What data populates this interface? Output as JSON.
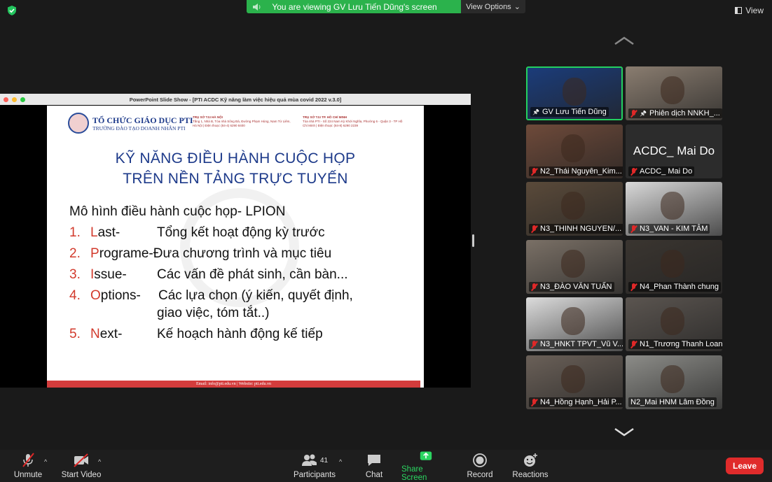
{
  "banner": {
    "text": "You are viewing GV Lưu Tiến Dũng's screen",
    "view_options": "View Options"
  },
  "view_label": "View",
  "shared_window": {
    "title": "PowerPoint Slide Show - [PTI ACDC Kỹ năng làm việc hiệu quả mùa covid 2022 v.3.0]"
  },
  "slide": {
    "org_name": "TỔ CHỨC GIÁO DỤC PTI",
    "org_sub": "TRƯỜNG ĐÀO TẠO DOANH NHÂN PTI",
    "addr_hn_title": "TRỤ SỞ TẠI HÀ NỘI",
    "addr_hn": "Tầng 1, Nhà B, Tòa nhà Sông Đà, Đường Phạm Hùng, Nam Từ Liêm, Hà Nội | Điện thoại: (84-4) 6290 8400",
    "addr_hcm_title": "TRỤ SỞ TẠI TP. HỒ CHÍ MINH",
    "addr_hcm": "Tòa nhà PTI - Số 224 Nam Kỳ Khởi Nghĩa, Phường 6 - Quận 3 - TP Hồ Chí Minh | Điện thoại: (84-8) 6290 2239",
    "title_line1": "KỸ NĂNG ĐIỀU HÀNH CUỘC HỌP",
    "title_line2": "TRÊN NỀN TẢNG TRỰC TUYẾN",
    "model": "Mô hình điều hành cuộc họp- LPION",
    "items": [
      {
        "num": "1.",
        "cap": "L",
        "rest": "ast-",
        "desc": "Tổng kết hoạt động kỳ trước"
      },
      {
        "num": "2.",
        "cap": "P",
        "rest": "rograme-",
        "desc": "Đưa chương trình và mục tiêu"
      },
      {
        "num": "3.",
        "cap": "I",
        "rest": "ssue-",
        "desc": "Các vấn đề phát sinh, cần bàn..."
      },
      {
        "num": "4.",
        "cap": "O",
        "rest": "ptions-",
        "desc": "Các lựa chọn (ý kiến, quyết định,",
        "desc2": "giao việc, tóm tắt..)"
      },
      {
        "num": "5.",
        "cap": "N",
        "rest": "ext-",
        "desc": "Kế hoạch hành động kế tiếp"
      }
    ],
    "footer": "Email: info@pti.edu.vn | Website: pti.edu.vn"
  },
  "participants": [
    {
      "name": "GV Lưu Tiến Dũng",
      "active": true,
      "muted": false,
      "pinned": true
    },
    {
      "name": "Phiên dịch NNKH_...",
      "muted": true,
      "pinned": true
    },
    {
      "name": "N2_Thái Nguyên_Kim...",
      "muted": true
    },
    {
      "name": "ACDC_ Mai Do",
      "muted": true,
      "display_name": "ACDC_ Mai Do"
    },
    {
      "name": "N3_THINH NGUYEN/...",
      "muted": true
    },
    {
      "name": "N3_VAN - KIM TÂM",
      "muted": true
    },
    {
      "name": "N3_ĐÀO VĂN TUẤN",
      "muted": true
    },
    {
      "name": "N4_Phan Thành chung",
      "muted": true
    },
    {
      "name": "N3_HNKT TPVT_Vũ V...",
      "muted": true
    },
    {
      "name": "N1_Trương Thanh Loan",
      "muted": true
    },
    {
      "name": "N4_Hồng Hạnh_Hải P...",
      "muted": true
    },
    {
      "name": "N2_Mai HNM Lâm Đồng",
      "muted": false
    }
  ],
  "toolbar": {
    "unmute": "Unmute",
    "start_video": "Start Video",
    "participants": "Participants",
    "participants_count": "41",
    "chat": "Chat",
    "share_screen": "Share Screen",
    "record": "Record",
    "reactions": "Reactions",
    "leave": "Leave"
  },
  "colors": {
    "banner_green": "#2bb24c",
    "active_border": "#23d160",
    "leave_red": "#e02b2b",
    "slide_title_blue": "#1d3a8a",
    "slide_accent_red": "#d23a2c"
  }
}
